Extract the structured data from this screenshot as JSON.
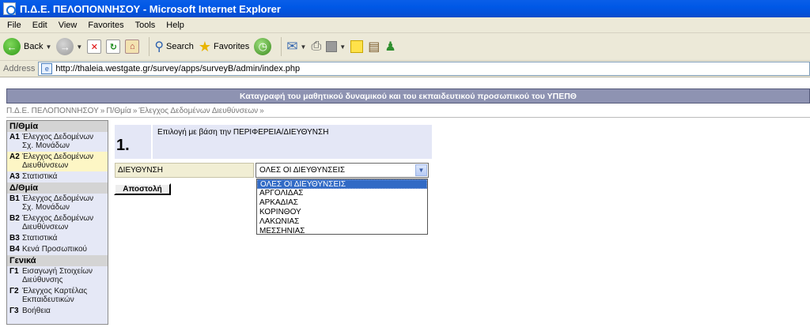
{
  "window": {
    "title": "Π.Δ.Ε. ΠΕΛΟΠΟΝΝΗΣΟΥ - Microsoft Internet Explorer"
  },
  "menubar": {
    "items": [
      "File",
      "Edit",
      "View",
      "Favorites",
      "Tools",
      "Help"
    ]
  },
  "toolbar": {
    "back_label": "Back",
    "search_label": "Search",
    "favorites_label": "Favorites"
  },
  "address": {
    "label": "Address",
    "url": "http://thaleia.westgate.gr/survey/apps/surveyB/admin/index.php"
  },
  "page": {
    "banner": "Καταγραφή του μαθητικού δυναμικού και του εκπαιδευτικού προσωπικού του ΥΠΕΠΘ",
    "breadcrumb": [
      "Π.Δ.Ε. ΠΕΛΟΠΟΝΝΗΣΟΥ",
      "Π/Θμία",
      "Έλεγχος Δεδομένων Διευθύνσεων"
    ],
    "breadcrumb_separator": "»",
    "sidebar": {
      "sections": [
        {
          "header": "Π/Θμία",
          "items": [
            {
              "code": "Α1",
              "label": "Έλεγχος Δεδομένων Σχ. Μονάδων",
              "active": false
            },
            {
              "code": "Α2",
              "label": "Έλεγχος Δεδομένων Διευθύνσεων",
              "active": true
            },
            {
              "code": "Α3",
              "label": "Στατιστικά",
              "active": false
            }
          ]
        },
        {
          "header": "Δ/Θμία",
          "items": [
            {
              "code": "Β1",
              "label": "Έλεγχος Δεδομένων Σχ. Μονάδων",
              "active": false
            },
            {
              "code": "Β2",
              "label": "Έλεγχος Δεδομένων Διευθύνσεων",
              "active": false
            },
            {
              "code": "Β3",
              "label": "Στατιστικά",
              "active": false
            },
            {
              "code": "Β4",
              "label": "Κενά Προσωπικού",
              "active": false
            }
          ]
        },
        {
          "header": "Γενικά",
          "items": [
            {
              "code": "Γ1",
              "label": "Εισαγωγή Στοιχείων Διεύθυνσης",
              "active": false
            },
            {
              "code": "Γ2",
              "label": "Έλεγχος Καρτέλας Εκπαιδευτικών",
              "active": false
            },
            {
              "code": "Γ3",
              "label": "Βοήθεια",
              "active": false
            }
          ]
        }
      ]
    },
    "step": {
      "number": "1.",
      "description": "Επιλογή με βάση την ΠΕΡΙΦΕΡΕΙΑ/ΔΙΕΥΘΥΝΣΗ"
    },
    "form": {
      "field_label": "ΔΙΕΥΘΥΝΣΗ",
      "selected_value": "ΟΛΕΣ ΟΙ ΔΙΕΥΘΥΝΣΕΙΣ",
      "options": [
        "ΟΛΕΣ ΟΙ ΔΙΕΥΘΥΝΣΕΙΣ",
        "ΑΡΓΟΛΙΔΑΣ",
        "ΑΡΚΑΔΙΑΣ",
        "ΚΟΡΙΝΘΟΥ",
        "ΛΑΚΩΝΙΑΣ",
        "ΜΕΣΣΗΝΙΑΣ"
      ],
      "submit_label": "Αποστολή"
    }
  }
}
